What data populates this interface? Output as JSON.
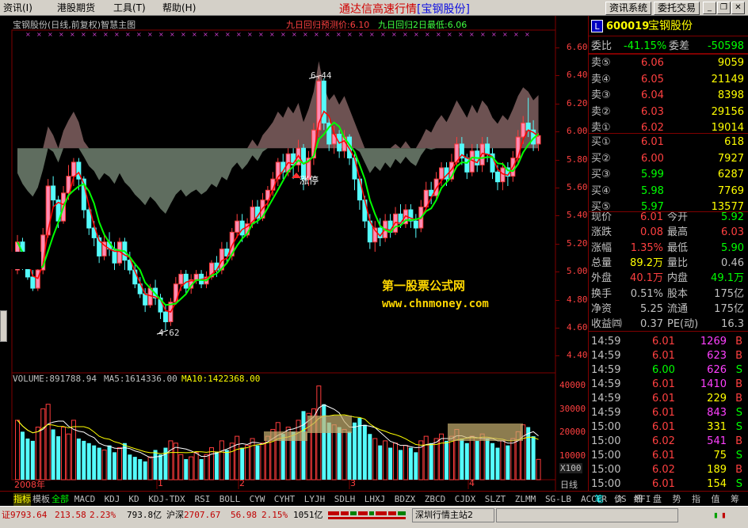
{
  "menu": [
    "资讯(I)",
    "港股期货",
    "工具(T)",
    "帮助(H)"
  ],
  "app_title": {
    "main": "通达信高速行情",
    "sub": "[宝钢股份]"
  },
  "toolbar": {
    "info_button": "资讯系统",
    "order_button": "委托交易"
  },
  "chart": {
    "header": "宝钢股份(日线,前复权)智慧主图",
    "forecast_label": "九日回归预测价:6.10",
    "low_label": "九日回归2日最低:6.06",
    "limit_up_label": "涨停",
    "peak_label": "6.44",
    "trough_label": "4.62",
    "price_axis": [
      "6.60",
      "6.40",
      "6.20",
      "6.00",
      "5.80",
      "5.60",
      "5.40",
      "5.20",
      "5.00",
      "4.80",
      "4.60",
      "4.40"
    ],
    "volume_header": {
      "vol": "VOLUME:891788.94",
      "ma5": "MA5:1614336.00",
      "ma10": "MA10:1422368.00"
    },
    "volume_axis": [
      "40000",
      "30000",
      "20000",
      "10000"
    ],
    "volume_unit": "X100",
    "time_axis": [
      "2008年",
      "1",
      "2",
      "3",
      "4"
    ],
    "period": "日线",
    "colors": {
      "up": "#ff3c3c",
      "down": "#54fcfc",
      "ma_red": "#ff0000",
      "ma_green": "#00ff00",
      "cloud_dark": "#708070",
      "cloud_brown": "#806060"
    }
  },
  "watermark": {
    "line1": "第一股票公式网",
    "line2": "www.chnmoney.com"
  },
  "quote": {
    "code": "600019",
    "name": "宝钢股份",
    "weibi_label": "委比",
    "weibi": "-41.15%",
    "weicha_label": "委差",
    "weicha": "-50598",
    "asks": [
      {
        "label": "卖⑤",
        "price": "6.06",
        "vol": "9059"
      },
      {
        "label": "卖④",
        "price": "6.05",
        "vol": "21149"
      },
      {
        "label": "卖③",
        "price": "6.04",
        "vol": "8398"
      },
      {
        "label": "卖②",
        "price": "6.03",
        "vol": "29156"
      },
      {
        "label": "卖①",
        "price": "6.02",
        "vol": "19014"
      }
    ],
    "bids": [
      {
        "label": "买①",
        "price": "6.01",
        "vol": "618"
      },
      {
        "label": "买②",
        "price": "6.00",
        "vol": "7927"
      },
      {
        "label": "买③",
        "price": "5.99",
        "vol": "6287"
      },
      {
        "label": "买④",
        "price": "5.98",
        "vol": "7769"
      },
      {
        "label": "买⑤",
        "price": "5.97",
        "vol": "13577"
      }
    ],
    "stats": [
      {
        "l1": "现价",
        "v1": "6.01",
        "l2": "今开",
        "v2": "5.92"
      },
      {
        "l1": "涨跌",
        "v1": "0.08",
        "l2": "最高",
        "v2": "6.03"
      },
      {
        "l1": "涨幅",
        "v1": "1.35%",
        "l2": "最低",
        "v2": "5.90"
      },
      {
        "l1": "总量",
        "v1": "89.2万",
        "l2": "量比",
        "v2": "0.46"
      },
      {
        "l1": "外盘",
        "v1": "40.1万",
        "l2": "内盘",
        "v2": "49.1万"
      },
      {
        "l1": "换手",
        "v1": "0.51%",
        "l2": "股本",
        "v2": "175亿"
      },
      {
        "l1": "净资",
        "v1": "5.25",
        "l2": "流通",
        "v2": "175亿"
      },
      {
        "l1": "收益㈣",
        "v1": "0.37",
        "l2": "PE(动)",
        "v2": "16.3"
      }
    ],
    "ticks": [
      {
        "t": "14:59",
        "p": "6.01",
        "v": "1269",
        "d": "B"
      },
      {
        "t": "14:59",
        "p": "6.01",
        "v": "623",
        "d": "B"
      },
      {
        "t": "14:59",
        "p": "6.00",
        "v": "626",
        "d": "S"
      },
      {
        "t": "14:59",
        "p": "6.01",
        "v": "1410",
        "d": "B"
      },
      {
        "t": "14:59",
        "p": "6.01",
        "v": "229",
        "d": "B"
      },
      {
        "t": "14:59",
        "p": "6.01",
        "v": "843",
        "d": "S"
      },
      {
        "t": "15:00",
        "p": "6.01",
        "v": "331",
        "d": "S"
      },
      {
        "t": "15:00",
        "p": "6.02",
        "v": "541",
        "d": "B"
      },
      {
        "t": "15:00",
        "p": "6.01",
        "v": "75",
        "d": "S"
      },
      {
        "t": "15:00",
        "p": "6.02",
        "v": "189",
        "d": "B"
      },
      {
        "t": "15:00",
        "p": "6.01",
        "v": "154",
        "d": "S"
      }
    ],
    "side_tabs": [
      "笔",
      "价",
      "细",
      "盘",
      "势",
      "指",
      "值",
      "筹"
    ]
  },
  "indicator_tabs": [
    "指标",
    "模板",
    "全部",
    "MACD",
    "KDJ",
    "KD",
    "KDJ-TDX",
    "RSI",
    "BOLL",
    "CYW",
    "CYHT",
    "LYJH",
    "SDLH",
    "LHXJ",
    "BDZX",
    "ZBCD",
    "CJDX",
    "SLZT",
    "ZLMM",
    "SG-LB",
    "ACCER",
    "JS",
    "MFI"
  ],
  "status": {
    "sh_index": "证9793.64",
    "sh_change": "213.58",
    "sh_pct": "2.23%",
    "sh_amount": "793.8亿",
    "hs_label": "沪深",
    "hs_index": "2707.67",
    "hs_change": "56.98",
    "hs_pct": "2.15%",
    "hs_amount": "1051亿",
    "server": "深圳行情主站2"
  },
  "candles": [
    [
      5.05,
      5.25,
      5.3,
      5.02
    ],
    [
      5.25,
      5.1,
      5.28,
      5.05
    ],
    [
      5.1,
      5.0,
      5.15,
      4.98
    ],
    [
      5.0,
      4.92,
      5.05,
      4.9
    ],
    [
      4.92,
      5.05,
      5.1,
      4.9
    ],
    [
      5.05,
      5.3,
      5.35,
      5.02
    ],
    [
      5.3,
      5.65,
      5.7,
      5.28
    ],
    [
      5.65,
      5.55,
      5.72,
      5.5
    ],
    [
      5.55,
      5.4,
      5.58,
      5.35
    ],
    [
      5.4,
      5.6,
      5.65,
      5.38
    ],
    [
      5.6,
      5.72,
      5.8,
      5.55
    ],
    [
      5.72,
      5.82,
      5.85,
      5.65
    ],
    [
      5.82,
      5.7,
      5.85,
      5.62
    ],
    [
      5.7,
      5.48,
      5.72,
      5.42
    ],
    [
      5.48,
      5.35,
      5.5,
      5.3
    ],
    [
      5.35,
      5.28,
      5.4,
      5.22
    ],
    [
      5.28,
      5.15,
      5.3,
      5.1
    ],
    [
      5.15,
      5.25,
      5.3,
      5.12
    ],
    [
      5.25,
      5.2,
      5.32,
      5.15
    ],
    [
      5.2,
      5.1,
      5.25,
      5.05
    ],
    [
      5.1,
      5.25,
      5.28,
      5.08
    ],
    [
      5.25,
      5.12,
      5.28,
      5.05
    ],
    [
      5.12,
      5.05,
      5.18,
      5.02
    ],
    [
      5.05,
      4.95,
      5.1,
      4.92
    ],
    [
      4.95,
      4.88,
      5.0,
      4.85
    ],
    [
      4.88,
      4.8,
      4.92,
      4.75
    ],
    [
      4.8,
      4.92,
      4.95,
      4.78
    ],
    [
      4.92,
      4.85,
      4.98,
      4.8
    ],
    [
      4.85,
      4.75,
      4.88,
      4.7
    ],
    [
      4.75,
      4.68,
      4.8,
      4.62
    ],
    [
      4.68,
      4.82,
      4.85,
      4.65
    ],
    [
      4.82,
      4.95,
      5.0,
      4.8
    ],
    [
      4.95,
      5.02,
      5.05,
      4.9
    ],
    [
      5.02,
      4.92,
      5.05,
      4.88
    ],
    [
      4.92,
      4.98,
      5.02,
      4.88
    ],
    [
      4.98,
      5.02,
      5.05,
      4.95
    ],
    [
      5.02,
      4.95,
      5.05,
      4.92
    ],
    [
      4.95,
      5.0,
      5.04,
      4.92
    ],
    [
      5.0,
      5.1,
      5.12,
      4.98
    ],
    [
      5.1,
      5.05,
      5.15,
      5.0
    ],
    [
      5.05,
      5.2,
      5.25,
      5.02
    ],
    [
      5.2,
      5.15,
      5.25,
      5.1
    ],
    [
      5.15,
      5.32,
      5.35,
      5.12
    ],
    [
      5.32,
      5.4,
      5.45,
      5.28
    ],
    [
      5.4,
      5.3,
      5.45,
      5.25
    ],
    [
      5.3,
      5.38,
      5.42,
      5.28
    ],
    [
      5.38,
      5.5,
      5.55,
      5.35
    ],
    [
      5.5,
      5.42,
      5.55,
      5.38
    ],
    [
      5.42,
      5.55,
      5.6,
      5.4
    ],
    [
      5.55,
      5.62,
      5.65,
      5.5
    ],
    [
      5.62,
      5.7,
      5.75,
      5.58
    ],
    [
      5.7,
      5.82,
      5.85,
      5.65
    ],
    [
      5.82,
      5.75,
      5.88,
      5.7
    ],
    [
      5.75,
      5.88,
      5.92,
      5.72
    ],
    [
      5.88,
      5.8,
      5.92,
      5.7
    ],
    [
      5.8,
      5.92,
      5.98,
      5.75
    ],
    [
      5.92,
      5.7,
      5.95,
      5.62
    ],
    [
      5.7,
      5.85,
      5.9,
      5.65
    ],
    [
      5.85,
      6.05,
      6.1,
      5.8
    ],
    [
      6.05,
      6.4,
      6.44,
      6.0
    ],
    [
      6.4,
      6.1,
      6.42,
      6.05
    ],
    [
      6.1,
      5.95,
      6.15,
      5.9
    ],
    [
      5.95,
      6.02,
      6.08,
      5.88
    ],
    [
      6.02,
      5.9,
      6.05,
      5.85
    ],
    [
      5.9,
      6.0,
      6.05,
      5.85
    ],
    [
      6.0,
      5.85,
      6.02,
      5.8
    ],
    [
      5.85,
      5.7,
      5.88,
      5.62
    ],
    [
      5.7,
      5.55,
      5.72,
      5.48
    ],
    [
      5.55,
      5.4,
      5.58,
      5.35
    ],
    [
      5.4,
      5.25,
      5.45,
      5.2
    ],
    [
      5.25,
      5.35,
      5.4,
      5.18
    ],
    [
      5.35,
      5.28,
      5.42,
      5.22
    ],
    [
      5.28,
      5.4,
      5.45,
      5.25
    ],
    [
      5.4,
      5.32,
      5.45,
      5.28
    ],
    [
      5.32,
      5.45,
      5.5,
      5.3
    ],
    [
      5.45,
      5.38,
      5.52,
      5.35
    ],
    [
      5.38,
      5.48,
      5.52,
      5.35
    ],
    [
      5.48,
      5.4,
      5.52,
      5.35
    ],
    [
      5.4,
      5.35,
      5.45,
      5.28
    ],
    [
      5.35,
      5.5,
      5.55,
      5.32
    ],
    [
      5.5,
      5.62,
      5.68,
      5.48
    ],
    [
      5.62,
      5.58,
      5.68,
      5.52
    ],
    [
      5.58,
      5.7,
      5.75,
      5.55
    ],
    [
      5.7,
      5.78,
      5.82,
      5.65
    ],
    [
      5.78,
      5.7,
      5.82,
      5.65
    ],
    [
      5.7,
      5.82,
      5.88,
      5.68
    ],
    [
      5.82,
      5.95,
      6.0,
      5.78
    ],
    [
      5.95,
      5.85,
      6.0,
      5.8
    ],
    [
      5.85,
      5.75,
      5.88,
      5.7
    ],
    [
      5.75,
      5.9,
      5.95,
      5.72
    ],
    [
      5.9,
      5.8,
      5.95,
      5.75
    ],
    [
      5.8,
      5.95,
      6.0,
      5.75
    ],
    [
      5.95,
      5.88,
      6.0,
      5.82
    ],
    [
      5.88,
      5.75,
      5.92,
      5.7
    ],
    [
      5.75,
      5.68,
      5.8,
      5.62
    ],
    [
      5.68,
      5.78,
      5.82,
      5.62
    ],
    [
      5.78,
      5.72,
      5.82,
      5.65
    ],
    [
      5.72,
      5.85,
      5.9,
      5.68
    ],
    [
      5.85,
      6.0,
      6.05,
      5.8
    ],
    [
      6.0,
      6.1,
      6.15,
      5.95
    ],
    [
      6.1,
      6.05,
      6.28,
      6.0
    ],
    [
      6.05,
      5.95,
      6.12,
      5.9
    ],
    [
      5.95,
      6.01,
      6.03,
      5.9
    ]
  ],
  "volumes": [
    260,
    210,
    180,
    170,
    230,
    310,
    330,
    220,
    190,
    230,
    200,
    260,
    180,
    170,
    160,
    150,
    140,
    130,
    150,
    120,
    140,
    160,
    110,
    100,
    90,
    80,
    100,
    130,
    110,
    140,
    170,
    160,
    110,
    90,
    100,
    120,
    90,
    110,
    140,
    120,
    170,
    130,
    160,
    190,
    140,
    150,
    180,
    150,
    160,
    190,
    220,
    250,
    200,
    230,
    210,
    260,
    300,
    290,
    310,
    410,
    330,
    250,
    240,
    230,
    220,
    210,
    250,
    270,
    240,
    200,
    180,
    150,
    170,
    140,
    160,
    130,
    150,
    140,
    120,
    170,
    190,
    160,
    180,
    200,
    170,
    190,
    220,
    180,
    160,
    190,
    170,
    200,
    180,
    160,
    140,
    170,
    150,
    180,
    210,
    240,
    230,
    190,
    89
  ]
}
